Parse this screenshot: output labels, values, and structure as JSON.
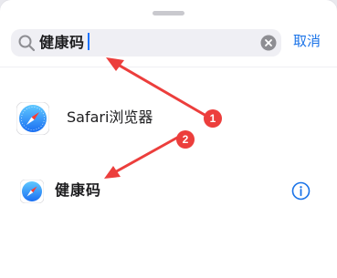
{
  "search": {
    "query": "健康码",
    "cancel_label": "取消"
  },
  "results": [
    {
      "label": "Safari浏览器",
      "icon": "safari-icon"
    },
    {
      "label": "健康码",
      "icon": "safari-icon",
      "trailing_icon": "info-icon"
    }
  ],
  "annotations": {
    "badge_1": "1",
    "badge_2": "2",
    "color": "#ec3e3c"
  },
  "colors": {
    "accent": "#1a73e8",
    "search_bg": "#efeff4"
  }
}
